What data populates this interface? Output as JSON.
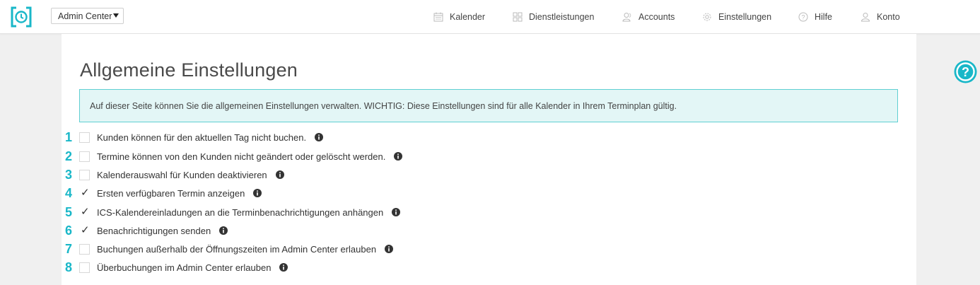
{
  "header": {
    "logo_icon": "clock-bracket-logo-icon",
    "center_select": {
      "value": "Admin Center"
    },
    "nav": [
      {
        "label": "Kalender",
        "icon": "calendar-icon"
      },
      {
        "label": "Dienstleistungen",
        "icon": "grid-icon"
      },
      {
        "label": "Accounts",
        "icon": "users-icon"
      },
      {
        "label": "Einstellungen",
        "icon": "gear-icon"
      },
      {
        "label": "Hilfe",
        "icon": "help-circle-icon"
      },
      {
        "label": "Konto",
        "icon": "user-icon"
      }
    ]
  },
  "main": {
    "title": "Allgemeine Einstellungen",
    "notice": "Auf dieser Seite können Sie die allgemeinen Einstellungen verwalten. WICHTIG: Diese Einstellungen sind für alle Kalender in Ihrem Terminplan gültig.",
    "options": [
      {
        "num": "1",
        "label": "Kunden können für den aktuellen Tag nicht buchen.",
        "checked": false
      },
      {
        "num": "2",
        "label": "Termine können von den Kunden nicht geändert oder gelöscht werden.",
        "checked": false
      },
      {
        "num": "3",
        "label": "Kalenderauswahl für Kunden deaktivieren",
        "checked": false
      },
      {
        "num": "4",
        "label": "Ersten verfügbaren Termin anzeigen",
        "checked": true
      },
      {
        "num": "5",
        "label": "ICS-Kalendereinladungen an die Terminbenachrichtigungen anhängen",
        "checked": true
      },
      {
        "num": "6",
        "label": "Benachrichtigungen senden",
        "checked": true
      },
      {
        "num": "7",
        "label": "Buchungen außerhalb der Öffnungszeiten im Admin Center erlauben",
        "checked": false
      },
      {
        "num": "8",
        "label": "Überbuchungen im Admin Center erlauben",
        "checked": false
      }
    ],
    "check_glyph": "✓"
  },
  "colors": {
    "accent": "#19b7c8",
    "notice_bg": "#e3f6f6",
    "notice_border": "#5fcfd2"
  },
  "floating_help_icon": "help-circle-icon"
}
